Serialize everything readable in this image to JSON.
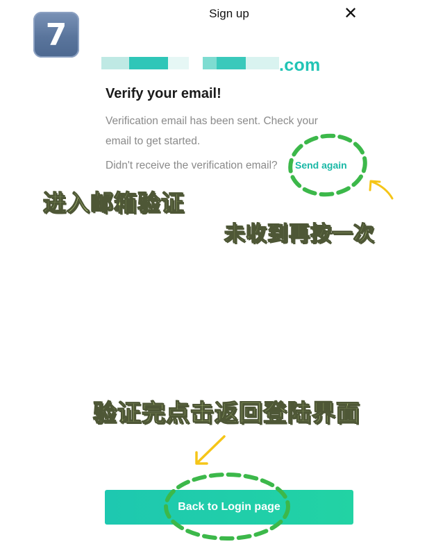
{
  "step_badge": "7",
  "header": {
    "title": "Sign up",
    "close_glyph": "✕"
  },
  "email": {
    "suffix": ".com"
  },
  "content": {
    "title": "Verify your email!",
    "description": "Verification email has been sent. Check your email to get started.",
    "resend_prompt": "Didn't receive the verification email?",
    "send_again_label": "Send again"
  },
  "annotations": {
    "enter_mailbox": "进入邮箱验证",
    "not_received": "未收到再按一次",
    "after_verify": "验证完点击返回登陆界面"
  },
  "primary_button": {
    "label": "Back to Login page"
  },
  "colors": {
    "accent": "#1ec8b0",
    "annotation_fill": "#d7ef95",
    "dashed_circle": "#3cb84a",
    "arrow": "#f5c518"
  }
}
